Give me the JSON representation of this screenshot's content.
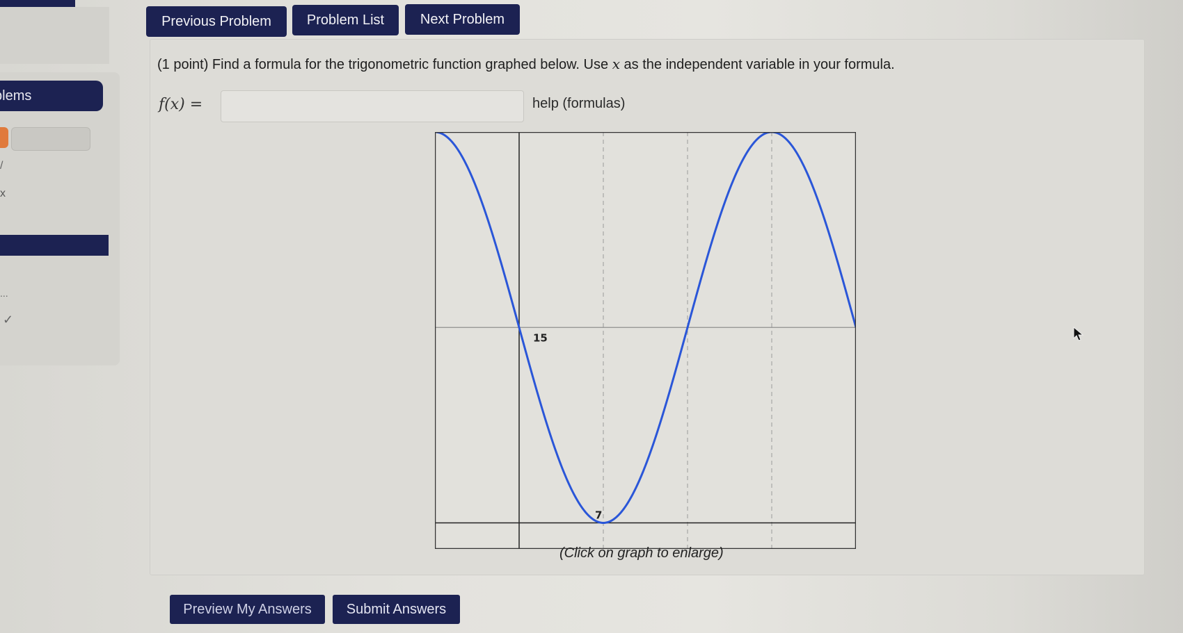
{
  "nav": {
    "previous_label": "Previous Problem",
    "list_label": "Problem List",
    "next_label": "Next Problem"
  },
  "sidebar": {
    "problems_label": "blems",
    "marks": [
      "/",
      "x",
      "...",
      "✓"
    ]
  },
  "problem": {
    "prefix": "(1 point) Find a formula for the trigonometric function graphed below. Use",
    "variable": "x",
    "suffix": "as the independent variable in your formula.",
    "function_label": "f(x)",
    "equals": "=",
    "input_value": "",
    "help_label": "help (formulas)"
  },
  "graph": {
    "caption": "(Click on graph to enlarge)",
    "value_label": "15",
    "x_label": "7",
    "curve_color": "#2a56d8"
  },
  "chart_data": {
    "type": "line",
    "title": "",
    "xlabel": "",
    "ylabel": "",
    "labels_on_graph": [
      "15",
      "7"
    ],
    "grid": true,
    "series": [
      {
        "function_shape": "sinusoid",
        "x": [
          -7,
          0,
          7,
          14,
          21,
          28
        ],
        "y": [
          30,
          15,
          0,
          15,
          30,
          15
        ]
      }
    ]
  },
  "actions": {
    "preview_label": "Preview My Answers",
    "submit_label": "Submit Answers"
  }
}
